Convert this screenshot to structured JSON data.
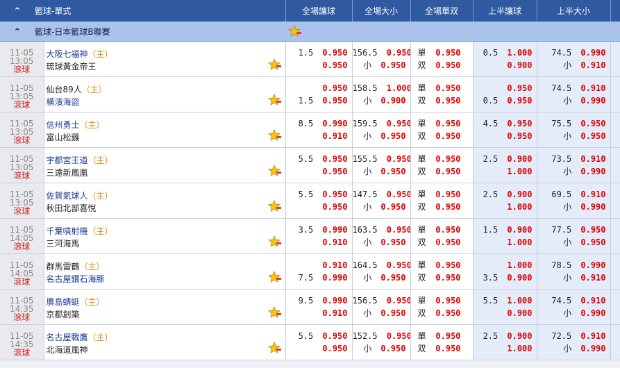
{
  "header": {
    "title": "籃球-單式",
    "cols": [
      "全場讓球",
      "全場大小",
      "全場單双",
      "上半讓球",
      "上半大小"
    ]
  },
  "league": {
    "name": "籃球-日本籃球B聯賽"
  },
  "labels": {
    "home": "（主）",
    "live": "滾球",
    "over": "小",
    "odd": "單",
    "even": "双"
  },
  "matches": [
    {
      "date": "11-05",
      "time": "13:05",
      "team1": "大阪七福神",
      "team2": "琉球黃金帝王",
      "home": 1,
      "team1Color": "blue",
      "team2Color": "black",
      "fh": [
        "1.5",
        "0.950",
        "",
        "0.950"
      ],
      "fou": [
        "156.5",
        "0.950",
        "小",
        "0.950"
      ],
      "oe": [
        "0.950",
        "0.950"
      ],
      "hh": [
        "0.5",
        "1.000",
        "",
        "0.900"
      ],
      "hou": [
        "74.5",
        "0.990",
        "小",
        "0.910"
      ]
    },
    {
      "date": "11-05",
      "time": "13:05",
      "team1": "仙台89人",
      "team2": "橫濱海盜",
      "home": 1,
      "team1Color": "black",
      "team2Color": "blue",
      "fh": [
        "",
        "0.950",
        "1.5",
        "0.950"
      ],
      "fou": [
        "158.5",
        "1.000",
        "小",
        "0.900"
      ],
      "oe": [
        "0.950",
        "0.950"
      ],
      "hh": [
        "",
        "0.950",
        "0.5",
        "0.950"
      ],
      "hou": [
        "74.5",
        "0.910",
        "小",
        "0.990"
      ]
    },
    {
      "date": "11-05",
      "time": "13:05",
      "team1": "信州勇士",
      "team2": "富山松雞",
      "home": 1,
      "team1Color": "blue",
      "team2Color": "black",
      "fh": [
        "8.5",
        "0.990",
        "",
        "0.910"
      ],
      "fou": [
        "159.5",
        "0.950",
        "小",
        "0.950"
      ],
      "oe": [
        "0.950",
        "0.950"
      ],
      "hh": [
        "4.5",
        "0.950",
        "",
        "0.950"
      ],
      "hou": [
        "75.5",
        "0.950",
        "小",
        "0.950"
      ]
    },
    {
      "date": "11-05",
      "time": "13:05",
      "team1": "宇都宮王道",
      "team2": "三遠新鳳凰",
      "home": 1,
      "team1Color": "blue",
      "team2Color": "black",
      "fh": [
        "5.5",
        "0.950",
        "",
        "0.950"
      ],
      "fou": [
        "155.5",
        "0.950",
        "小",
        "0.950"
      ],
      "oe": [
        "0.950",
        "0.950"
      ],
      "hh": [
        "2.5",
        "0.900",
        "",
        "1.000"
      ],
      "hou": [
        "73.5",
        "0.910",
        "小",
        "0.990"
      ]
    },
    {
      "date": "11-05",
      "time": "13:05",
      "team1": "佐賀氣球人",
      "team2": "秋田北部喜悅",
      "home": 1,
      "team1Color": "blue",
      "team2Color": "black",
      "fh": [
        "5.5",
        "0.950",
        "",
        "0.950"
      ],
      "fou": [
        "147.5",
        "0.950",
        "小",
        "0.950"
      ],
      "oe": [
        "0.950",
        "0.950"
      ],
      "hh": [
        "2.5",
        "0.900",
        "",
        "1.000"
      ],
      "hou": [
        "69.5",
        "0.910",
        "小",
        "0.990"
      ]
    },
    {
      "date": "11-05",
      "time": "14:05",
      "team1": "千葉噴射機",
      "team2": "三河海馬",
      "home": 1,
      "team1Color": "blue",
      "team2Color": "black",
      "fh": [
        "3.5",
        "0.990",
        "",
        "0.910"
      ],
      "fou": [
        "163.5",
        "0.950",
        "小",
        "0.950"
      ],
      "oe": [
        "0.950",
        "0.950"
      ],
      "hh": [
        "1.5",
        "0.900",
        "",
        "1.000"
      ],
      "hou": [
        "77.5",
        "0.950",
        "小",
        "0.950"
      ]
    },
    {
      "date": "11-05",
      "time": "14:05",
      "team1": "群馬雷鶴",
      "team2": "名古屋鑽石海豚",
      "home": 1,
      "team1Color": "black",
      "team2Color": "blue",
      "fh": [
        "",
        "0.910",
        "7.5",
        "0.990"
      ],
      "fou": [
        "164.5",
        "0.950",
        "小",
        "0.950"
      ],
      "oe": [
        "0.950",
        "0.950"
      ],
      "hh": [
        "",
        "1.000",
        "3.5",
        "0.900"
      ],
      "hou": [
        "78.5",
        "0.990",
        "小",
        "0.910"
      ]
    },
    {
      "date": "11-05",
      "time": "14:35",
      "team1": "廣島蜻蜓",
      "team2": "京都創築",
      "home": 1,
      "team1Color": "blue",
      "team2Color": "black",
      "fh": [
        "9.5",
        "0.990",
        "",
        "0.910"
      ],
      "fou": [
        "156.5",
        "0.950",
        "小",
        "0.950"
      ],
      "oe": [
        "0.950",
        "0.950"
      ],
      "hh": [
        "5.5",
        "1.000",
        "",
        "0.900"
      ],
      "hou": [
        "74.5",
        "0.910",
        "小",
        "0.990"
      ]
    },
    {
      "date": "11-05",
      "time": "14:35",
      "team1": "名古屋戰鷹",
      "team2": "北海道風神",
      "home": 1,
      "team1Color": "blue",
      "team2Color": "black",
      "fh": [
        "5.5",
        "0.950",
        "",
        "0.950"
      ],
      "fou": [
        "152.5",
        "0.950",
        "小",
        "0.950"
      ],
      "oe": [
        "0.950",
        "0.950"
      ],
      "hh": [
        "2.5",
        "0.900",
        "",
        "1.000"
      ],
      "hou": [
        "72.5",
        "0.910",
        "小",
        "0.990"
      ]
    }
  ],
  "colors": {
    "header": "#2f5aa0",
    "league": "#aac3ea",
    "odds": "#e00000",
    "teamBlue": "#1e3c96",
    "home": "#e08a10",
    "live": "#d42020",
    "halfBg": "#e4ecf9"
  }
}
